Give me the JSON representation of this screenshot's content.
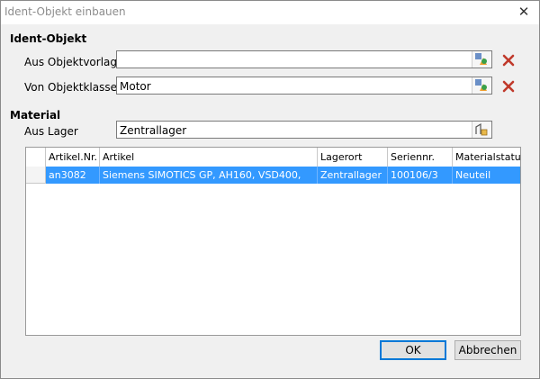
{
  "window": {
    "title": "Ident-Objekt einbauen"
  },
  "ident_section": {
    "heading": "Ident-Objekt",
    "vorlage": {
      "label": "Aus Objektvorlage",
      "value": ""
    },
    "klasse": {
      "label": "Von Objektklasse",
      "value": "Motor"
    }
  },
  "material_section": {
    "heading": "Material",
    "lager": {
      "label": "Aus Lager",
      "value": "Zentrallager"
    }
  },
  "table": {
    "columns": [
      "Artikel.Nr.",
      "Artikel",
      "Lagerort",
      "Seriennr.",
      "Materialstatus"
    ],
    "rows": [
      [
        "an3082",
        "Siemens SIMOTICS GP, AH160, VSD400,",
        "Zentrallager",
        "100106/3",
        "Neuteil"
      ]
    ]
  },
  "buttons": {
    "ok": "OK",
    "cancel": "Abbrechen"
  },
  "colors": {
    "selection": "#3399ff",
    "delete": "#c0392b",
    "default_border": "#0078d7"
  },
  "icons": [
    "close-icon",
    "browse-template-icon",
    "delete-icon",
    "warehouse-select-icon"
  ]
}
